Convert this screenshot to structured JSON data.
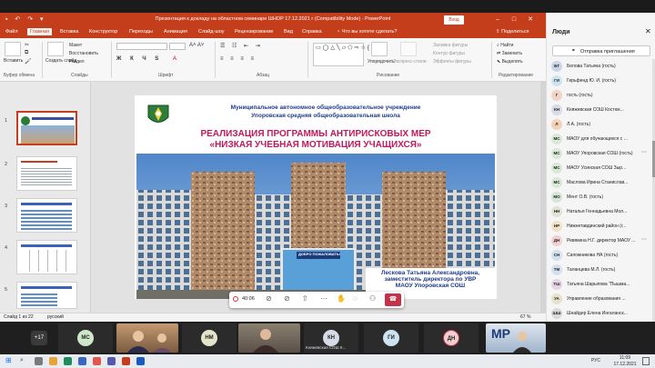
{
  "window": {
    "title": "Презентация к докладу на областном семинаре ШНОР 17.12.2021 г (Compatibility Mode)  -  PowerPoint",
    "login": "Вход"
  },
  "menu": {
    "items": [
      "Файл",
      "Главная",
      "Вставка",
      "Конструктор",
      "Переходы",
      "Анимация",
      "Слайд-шоу",
      "Рецензирование",
      "Вид",
      "Справка"
    ],
    "search": "Что вы хотите сделать?",
    "share": "Поделиться"
  },
  "ribbon": {
    "paste": "Вставить",
    "cut": "Вырезать",
    "copy": "Копировать",
    "format_painter": "Формат по образцу",
    "new_slide": "Создать слайд",
    "layout": "Макет",
    "reset": "Восстановить",
    "section": "Раздел",
    "arrange": "Упорядочить",
    "quick_styles": "Экспресс-стили",
    "shape_fill": "Заливка фигуры",
    "shape_outline": "Контур фигуры",
    "shape_effects": "Эффекты фигуры",
    "find": "Найти",
    "replace": "Заменить",
    "select": "Выделить",
    "groups": {
      "clipboard": "Буфер обмена",
      "slides": "Слайды",
      "font": "Шрифт",
      "paragraph": "Абзац",
      "drawing": "Рисование",
      "editing": "Редактирование"
    }
  },
  "slides": [
    {
      "n": "1"
    },
    {
      "n": "2"
    },
    {
      "n": "3"
    },
    {
      "n": "4"
    },
    {
      "n": "5"
    }
  ],
  "slide": {
    "org_line1": "Муниципальное автономное общеобразовательное учреждение",
    "org_line2": "Упоровская средняя общеобразовательная школа",
    "heading1": "РЕАЛИЗАЦИЯ ПРОГРАММЫ АНТИРИСКОВЫХ МЕР",
    "heading2": "«НИЗКАЯ УЧЕБНАЯ МОТИВАЦИЯ УЧАЩИХСЯ»",
    "building_sign": "ДОБРО ПОЖАЛОВАТЬ!",
    "caption1": "Лескова Татьяна Александровна,",
    "caption2": "заместитель директора по УВР",
    "caption3": "МАОУ Упоровская СОШ"
  },
  "status": {
    "slide": "Слайд 1 из 22",
    "lang": "русский",
    "zoom": "67 %"
  },
  "call": {
    "timer": "40:06"
  },
  "people": {
    "title": "Люди",
    "invite": "Отправка приглашения",
    "list": [
      {
        "initials": "БТ",
        "name": "Белова Татьяна (гость)",
        "color": "#c9d6e8"
      },
      {
        "initials": "ГИ",
        "name": "Гирьфенд Ю. И. (гость)",
        "color": "#cde4f0"
      },
      {
        "initials": "Г",
        "name": "гость (гость)",
        "color": "#f1d4c8"
      },
      {
        "initials": "КН",
        "name": "Княжевская СОШ Костюк...",
        "color": "#d6dbe6"
      },
      {
        "initials": "Л",
        "name": "Л.А. (гость)",
        "color": "#f3d3b8"
      },
      {
        "initials": "МС",
        "name": "МАОУ для обучающихся с ...",
        "color": "#d7ead3"
      },
      {
        "initials": "МС",
        "name": "МАОУ Упоровская СОШ (гость)",
        "color": "#d7ead3"
      },
      {
        "initials": "МС",
        "name": "МАОУ Усинская СОШ Зыр...",
        "color": "#d7ead3"
      },
      {
        "initials": "МС",
        "name": "Маслова Ирина Станислав...",
        "color": "#d7ead3"
      },
      {
        "initials": "МО",
        "name": "Мент О.В. (гость)",
        "color": "#d3e6d7"
      },
      {
        "initials": "НН",
        "name": "Наталья Геннадьевна Мол...",
        "color": "#dfe3d2"
      },
      {
        "initials": "НР",
        "name": "Нижнетавдинский район (г...",
        "color": "#f0e2c6"
      },
      {
        "initials": "ДН",
        "name": "Ревякина Н.Г. директор МАОУ ...",
        "color": "#f3d0cf"
      },
      {
        "initials": "СН",
        "name": "Сапожникова НА (гость)",
        "color": "#d2e0ef"
      },
      {
        "initials": "ТМ",
        "name": "Таланцева М.Л. (гость)",
        "color": "#d2e0ef"
      },
      {
        "initials": "ТШ",
        "name": "Татьяна Шарыпова \"Пышма...",
        "color": "#e6d3e4"
      },
      {
        "initials": "УА",
        "name": "Управление образования ...",
        "color": "#e6e2c9"
      },
      {
        "initials": "ШШ",
        "name": "Шнайдер Елена Ингаланск...",
        "color": "#d9d9d9"
      }
    ]
  },
  "strip": {
    "more": "+17",
    "tiles": [
      {
        "initials": "МС",
        "label": "",
        "color": "#cfe7c9"
      },
      {
        "initials": "НМ",
        "label": "",
        "color": "#e4e4c8"
      },
      {
        "initials": "КН",
        "label": "Княжевская СОШ К...",
        "color": "#d6dbe6"
      },
      {
        "initials": "ГИ",
        "label": "",
        "color": "#cde4f0"
      },
      {
        "initials": "ДН",
        "label": "",
        "color": "#f3d0cf"
      }
    ]
  },
  "taskbar": {
    "lang": "РУС",
    "time": "11:09",
    "date": "17.12.2021"
  }
}
